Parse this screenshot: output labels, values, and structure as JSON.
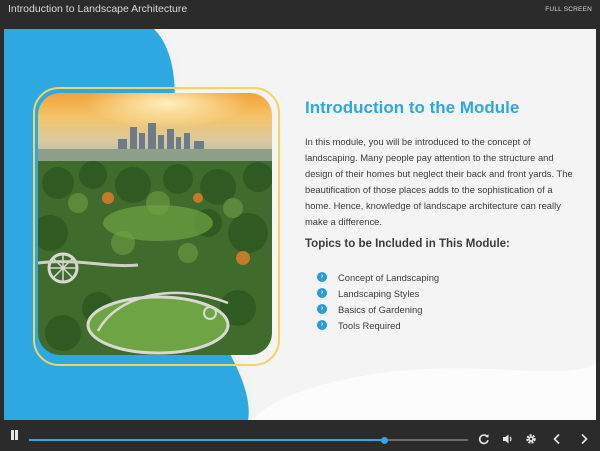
{
  "header": {
    "course_title": "Introduction to Landscape Architecture",
    "fullscreen_label": "FULL SCREEN"
  },
  "slide": {
    "heading": "Introduction to the Module",
    "intro_paragraph": "In this module, you will be introduced to the concept of landscaping. Many people pay attention to the structure and design of their homes but neglect their back and front yards. The beautification of those places adds to the sophistication of a home. Hence, knowledge of landscape architecture can really make a difference.",
    "topics_heading": "Topics to be Included in This Module:",
    "topics": [
      "Concept of Landscaping",
      "Landscaping Styles",
      "Basics of Gardening",
      "Tools Required"
    ],
    "image": "aerial-city-park-photo"
  },
  "player": {
    "progress_fraction": 0.81,
    "icons": [
      "pause-icon",
      "replay-icon",
      "volume-icon",
      "settings-icon",
      "prev-icon",
      "next-icon"
    ]
  },
  "colors": {
    "accent": "#2ea8e0",
    "frame": "#f2d45e",
    "bar": "#2b2b2b"
  }
}
